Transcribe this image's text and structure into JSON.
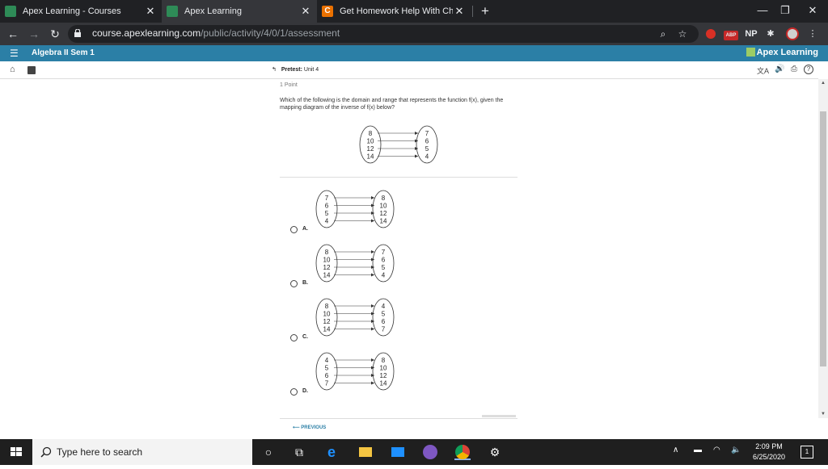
{
  "browser": {
    "tabs": [
      {
        "title": "Apex Learning - Courses",
        "active": false
      },
      {
        "title": "Apex Learning",
        "active": true
      },
      {
        "title": "Get Homework Help With Chegg",
        "active": false
      }
    ],
    "new_tab_label": "+",
    "url_host": "course.apexlearning.com",
    "url_path": "/public/activity/4/0/1/assessment",
    "profile_initials": "NP",
    "abp_label": "ABP"
  },
  "apex": {
    "course_title": "Algebra II Sem 1",
    "brand": "Apex Learning",
    "breadcrumb_label": "Pretest:",
    "breadcrumb_unit": "Unit 4"
  },
  "question": {
    "points": "1 Point",
    "text": "Which of the following is the domain and range that represents the function f(x), given the mapping diagram of the inverse of f(x) below?",
    "diagram": {
      "left": [
        "8",
        "10",
        "12",
        "14"
      ],
      "right": [
        "7",
        "6",
        "5",
        "4"
      ]
    }
  },
  "options": [
    {
      "label": "A.",
      "left": [
        "7",
        "6",
        "5",
        "4"
      ],
      "right": [
        "8",
        "10",
        "12",
        "14"
      ]
    },
    {
      "label": "B.",
      "left": [
        "8",
        "10",
        "12",
        "14"
      ],
      "right": [
        "7",
        "6",
        "5",
        "4"
      ]
    },
    {
      "label": "C.",
      "left": [
        "8",
        "10",
        "12",
        "14"
      ],
      "right": [
        "4",
        "5",
        "6",
        "7"
      ]
    },
    {
      "label": "D.",
      "left": [
        "4",
        "5",
        "6",
        "7"
      ],
      "right": [
        "8",
        "10",
        "12",
        "14"
      ]
    }
  ],
  "nav": {
    "previous": "PREVIOUS"
  },
  "taskbar": {
    "search_placeholder": "Type here to search",
    "time": "2:09 PM",
    "date": "6/25/2020",
    "notifications": "1"
  },
  "colors": {
    "apex_bar": "#2b7fa6",
    "chegg": "#eb7100",
    "tab_bg": "#202124",
    "active_tab": "#35363a"
  }
}
